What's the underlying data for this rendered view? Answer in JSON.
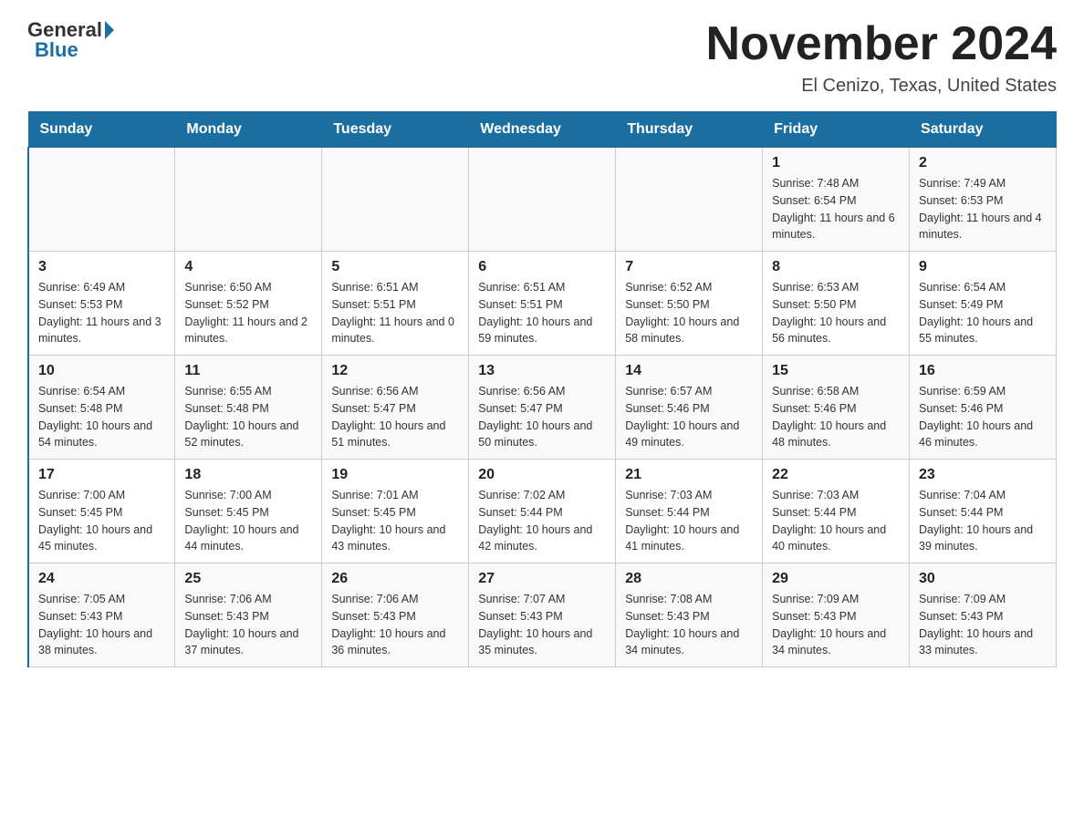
{
  "header": {
    "logo_general": "General",
    "logo_blue": "Blue",
    "month_title": "November 2024",
    "location": "El Cenizo, Texas, United States"
  },
  "weekdays": [
    "Sunday",
    "Monday",
    "Tuesday",
    "Wednesday",
    "Thursday",
    "Friday",
    "Saturday"
  ],
  "weeks": [
    [
      {
        "day": "",
        "info": ""
      },
      {
        "day": "",
        "info": ""
      },
      {
        "day": "",
        "info": ""
      },
      {
        "day": "",
        "info": ""
      },
      {
        "day": "",
        "info": ""
      },
      {
        "day": "1",
        "info": "Sunrise: 7:48 AM\nSunset: 6:54 PM\nDaylight: 11 hours and 6 minutes."
      },
      {
        "day": "2",
        "info": "Sunrise: 7:49 AM\nSunset: 6:53 PM\nDaylight: 11 hours and 4 minutes."
      }
    ],
    [
      {
        "day": "3",
        "info": "Sunrise: 6:49 AM\nSunset: 5:53 PM\nDaylight: 11 hours and 3 minutes."
      },
      {
        "day": "4",
        "info": "Sunrise: 6:50 AM\nSunset: 5:52 PM\nDaylight: 11 hours and 2 minutes."
      },
      {
        "day": "5",
        "info": "Sunrise: 6:51 AM\nSunset: 5:51 PM\nDaylight: 11 hours and 0 minutes."
      },
      {
        "day": "6",
        "info": "Sunrise: 6:51 AM\nSunset: 5:51 PM\nDaylight: 10 hours and 59 minutes."
      },
      {
        "day": "7",
        "info": "Sunrise: 6:52 AM\nSunset: 5:50 PM\nDaylight: 10 hours and 58 minutes."
      },
      {
        "day": "8",
        "info": "Sunrise: 6:53 AM\nSunset: 5:50 PM\nDaylight: 10 hours and 56 minutes."
      },
      {
        "day": "9",
        "info": "Sunrise: 6:54 AM\nSunset: 5:49 PM\nDaylight: 10 hours and 55 minutes."
      }
    ],
    [
      {
        "day": "10",
        "info": "Sunrise: 6:54 AM\nSunset: 5:48 PM\nDaylight: 10 hours and 54 minutes."
      },
      {
        "day": "11",
        "info": "Sunrise: 6:55 AM\nSunset: 5:48 PM\nDaylight: 10 hours and 52 minutes."
      },
      {
        "day": "12",
        "info": "Sunrise: 6:56 AM\nSunset: 5:47 PM\nDaylight: 10 hours and 51 minutes."
      },
      {
        "day": "13",
        "info": "Sunrise: 6:56 AM\nSunset: 5:47 PM\nDaylight: 10 hours and 50 minutes."
      },
      {
        "day": "14",
        "info": "Sunrise: 6:57 AM\nSunset: 5:46 PM\nDaylight: 10 hours and 49 minutes."
      },
      {
        "day": "15",
        "info": "Sunrise: 6:58 AM\nSunset: 5:46 PM\nDaylight: 10 hours and 48 minutes."
      },
      {
        "day": "16",
        "info": "Sunrise: 6:59 AM\nSunset: 5:46 PM\nDaylight: 10 hours and 46 minutes."
      }
    ],
    [
      {
        "day": "17",
        "info": "Sunrise: 7:00 AM\nSunset: 5:45 PM\nDaylight: 10 hours and 45 minutes."
      },
      {
        "day": "18",
        "info": "Sunrise: 7:00 AM\nSunset: 5:45 PM\nDaylight: 10 hours and 44 minutes."
      },
      {
        "day": "19",
        "info": "Sunrise: 7:01 AM\nSunset: 5:45 PM\nDaylight: 10 hours and 43 minutes."
      },
      {
        "day": "20",
        "info": "Sunrise: 7:02 AM\nSunset: 5:44 PM\nDaylight: 10 hours and 42 minutes."
      },
      {
        "day": "21",
        "info": "Sunrise: 7:03 AM\nSunset: 5:44 PM\nDaylight: 10 hours and 41 minutes."
      },
      {
        "day": "22",
        "info": "Sunrise: 7:03 AM\nSunset: 5:44 PM\nDaylight: 10 hours and 40 minutes."
      },
      {
        "day": "23",
        "info": "Sunrise: 7:04 AM\nSunset: 5:44 PM\nDaylight: 10 hours and 39 minutes."
      }
    ],
    [
      {
        "day": "24",
        "info": "Sunrise: 7:05 AM\nSunset: 5:43 PM\nDaylight: 10 hours and 38 minutes."
      },
      {
        "day": "25",
        "info": "Sunrise: 7:06 AM\nSunset: 5:43 PM\nDaylight: 10 hours and 37 minutes."
      },
      {
        "day": "26",
        "info": "Sunrise: 7:06 AM\nSunset: 5:43 PM\nDaylight: 10 hours and 36 minutes."
      },
      {
        "day": "27",
        "info": "Sunrise: 7:07 AM\nSunset: 5:43 PM\nDaylight: 10 hours and 35 minutes."
      },
      {
        "day": "28",
        "info": "Sunrise: 7:08 AM\nSunset: 5:43 PM\nDaylight: 10 hours and 34 minutes."
      },
      {
        "day": "29",
        "info": "Sunrise: 7:09 AM\nSunset: 5:43 PM\nDaylight: 10 hours and 34 minutes."
      },
      {
        "day": "30",
        "info": "Sunrise: 7:09 AM\nSunset: 5:43 PM\nDaylight: 10 hours and 33 minutes."
      }
    ]
  ]
}
